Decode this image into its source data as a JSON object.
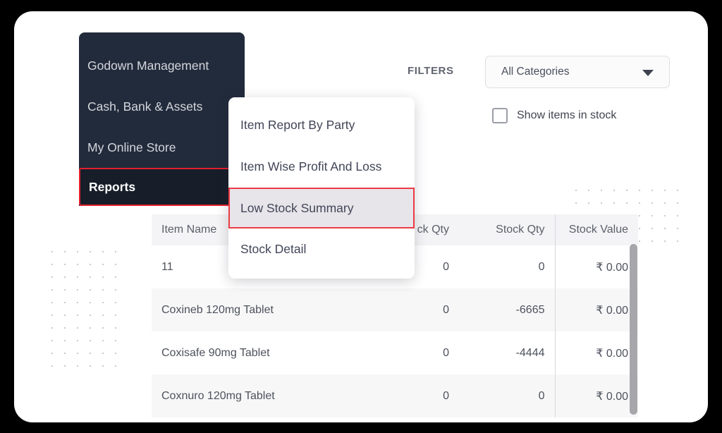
{
  "filters": {
    "label": "FILTERS",
    "category_select": {
      "value": "All Categories",
      "caret_icon": "chevron-down-icon"
    },
    "show_in_stock": {
      "label": "Show items in stock",
      "checked": false
    }
  },
  "sidebar": {
    "items": [
      {
        "label": "Godown Management",
        "active": false
      },
      {
        "label": "Cash, Bank & Assets",
        "active": false
      },
      {
        "label": "My Online Store",
        "active": false
      },
      {
        "label": "Reports",
        "active": true
      }
    ]
  },
  "submenu": {
    "items": [
      {
        "label": "Item Report By Party",
        "highlighted": false
      },
      {
        "label": "Item Wise Profit And Loss",
        "highlighted": false
      },
      {
        "label": "Low Stock Summary",
        "highlighted": true
      },
      {
        "label": "Stock Detail",
        "highlighted": false
      }
    ]
  },
  "table": {
    "headers": [
      "Item Name",
      "ck Qty",
      "Stock Qty",
      "Stock Value"
    ],
    "rows": [
      {
        "name": "11",
        "ck_qty": "0",
        "stock_qty": "0",
        "stock_value": "₹ 0.00"
      },
      {
        "name": "Coxineb 120mg Tablet",
        "ck_qty": "0",
        "stock_qty": "-6665",
        "stock_value": "₹ 0.00"
      },
      {
        "name": "Coxisafe 90mg Tablet",
        "ck_qty": "0",
        "stock_qty": "-4444",
        "stock_value": "₹ 0.00"
      },
      {
        "name": "Coxnuro 120mg Tablet",
        "ck_qty": "0",
        "stock_qty": "0",
        "stock_value": "₹ 0.00"
      }
    ]
  },
  "colors": {
    "sidebar_bg": "#222b3b",
    "sidebar_active_bg": "#171e29",
    "highlight_red": "#e5202e",
    "submenu_highlight_bg": "#e7e5ea",
    "card_bg": "#ffffff",
    "frame_bg": "#000000"
  }
}
